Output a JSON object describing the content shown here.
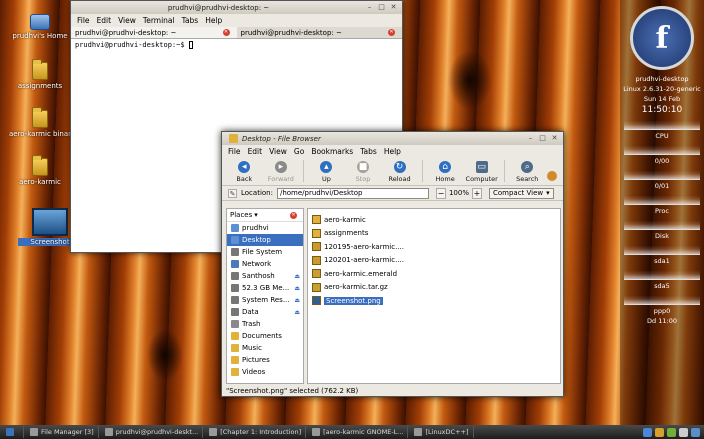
{
  "desktop": {
    "icons": [
      {
        "label": "prudhvi's Home"
      },
      {
        "label": "assignments"
      },
      {
        "label": "aero-karmic binar"
      },
      {
        "label": "aero-karmic"
      },
      {
        "label": "Screenshot"
      }
    ]
  },
  "terminal": {
    "title": "prudhvi@prudhvi-desktop: ~",
    "menu": [
      "File",
      "Edit",
      "View",
      "Terminal",
      "Tabs",
      "Help"
    ],
    "tabs": [
      {
        "label": "prudhvi@prudhvi-desktop: ~"
      },
      {
        "label": "prudhvi@prudhvi-desktop: ~"
      }
    ],
    "prompt": "prudhvi@prudhvi-desktop:~$"
  },
  "file_browser": {
    "title_folder": "Desktop",
    "title_app": "File Browser",
    "menu": [
      "File",
      "Edit",
      "View",
      "Go",
      "Bookmarks",
      "Tabs",
      "Help"
    ],
    "toolbar": [
      {
        "label": "Back",
        "icon": "arrow-left-icon",
        "color": "#2f6fc2"
      },
      {
        "label": "Forward",
        "icon": "arrow-right-icon",
        "color": "#8a8a8a"
      },
      {
        "label": "Up",
        "icon": "arrow-up-icon",
        "color": "#2f6fc2"
      },
      {
        "label": "Stop",
        "icon": "stop-icon",
        "color": "#a5a09a"
      },
      {
        "label": "Reload",
        "icon": "reload-icon",
        "color": "#2f6fc2"
      },
      {
        "label": "Home",
        "icon": "home-icon",
        "color": "#2f6fc2"
      },
      {
        "label": "Computer",
        "icon": "computer-icon",
        "color": "#4f6b8a"
      },
      {
        "label": "Search",
        "icon": "search-icon",
        "color": "#4f6b8a"
      }
    ],
    "location_label": "Location:",
    "location_value": "/home/prudhvi/Desktop",
    "zoom": "100%",
    "view_mode": "Compact View",
    "places_label": "Places",
    "places": [
      {
        "label": "prudhvi",
        "color": "#5b8fd6"
      },
      {
        "label": "Desktop",
        "color": "#5b8fd6",
        "selected": true
      },
      {
        "label": "File System",
        "color": "#777777"
      },
      {
        "label": "Network",
        "color": "#4a7ab8"
      },
      {
        "label": "Santhosh",
        "color": "#777777",
        "eject": true
      },
      {
        "label": "52.3 GB Me...",
        "color": "#777777",
        "eject": true
      },
      {
        "label": "System Res...",
        "color": "#777777",
        "eject": true
      },
      {
        "label": "Data",
        "color": "#777777",
        "eject": true
      },
      {
        "label": "Trash",
        "color": "#8a8a8a"
      },
      {
        "label": "Documents",
        "color": "#e0b23b"
      },
      {
        "label": "Music",
        "color": "#e0b23b"
      },
      {
        "label": "Pictures",
        "color": "#e0b23b"
      },
      {
        "label": "Videos",
        "color": "#e0b23b"
      }
    ],
    "files": [
      {
        "name": "aero-karmic",
        "color": "#e0b23b"
      },
      {
        "name": "assignments",
        "color": "#e0b23b"
      },
      {
        "name": "120195-aero-karmic....",
        "color": "#c99a2e"
      },
      {
        "name": "120201-aero-karmic....",
        "color": "#c99a2e"
      },
      {
        "name": "aero-karmic.emerald",
        "color": "#c9a030"
      },
      {
        "name": "aero-karmic.tar.gz",
        "color": "#c9a030"
      },
      {
        "name": "Screenshot.png",
        "color": "#2f5f93",
        "selected": true
      }
    ],
    "status": "\"Screenshot.png\" selected (762.2 KB)"
  },
  "conky": {
    "logo": "f",
    "lines": [
      {
        "text": "prudhvi-desktop"
      },
      {
        "text": "Linux 2.6.31-20-generic"
      },
      {
        "text": "Sun 14 Feb"
      },
      {
        "text": "11:50:10"
      }
    ],
    "graphs": [
      {
        "label": "CPU"
      },
      {
        "label": "0/00"
      },
      {
        "label": "0/01"
      },
      {
        "label": "Proc"
      },
      {
        "label": "Disk"
      },
      {
        "label": "sda1"
      },
      {
        "label": "sda5"
      },
      {
        "label": "ppp0"
      }
    ],
    "footer": "Dd 11:00"
  },
  "taskbar": {
    "tasks": [
      {
        "label": "File Manager [3]"
      },
      {
        "label": "prudhvi@prudhvi-deskt..."
      },
      {
        "label": "[Chapter 1: Introduction]"
      },
      {
        "label": "[aero-karmic GNOME-L..."
      },
      {
        "label": "[LinuxDC++]"
      }
    ],
    "tray_colors": [
      "#4a86d4",
      "#d6a12b",
      "#6fae3a",
      "#cccccc",
      "#5a8ec9"
    ]
  }
}
